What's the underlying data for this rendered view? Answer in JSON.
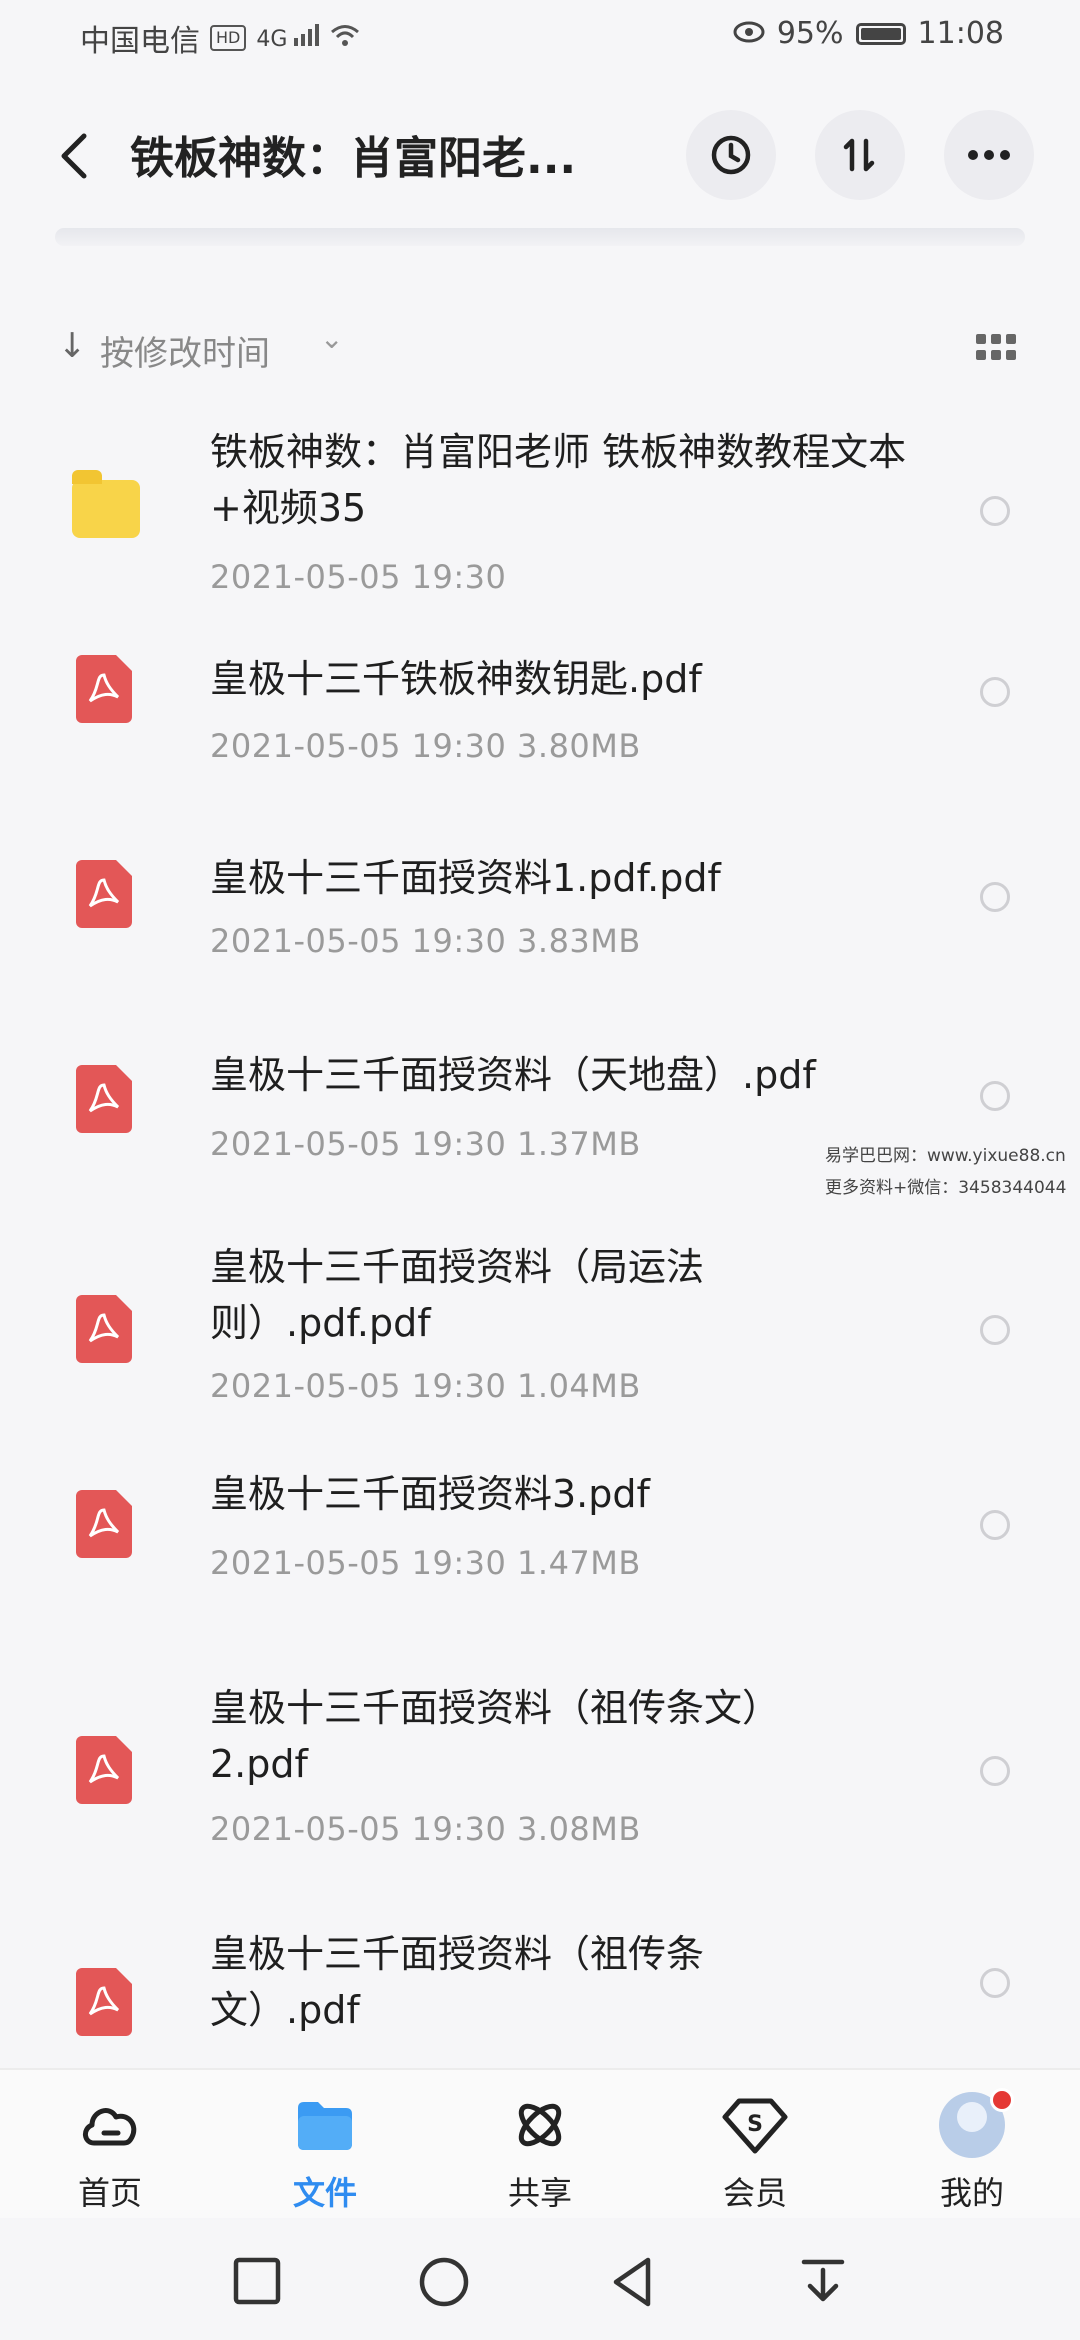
{
  "status": {
    "carrier": "中国电信",
    "hd": "HD",
    "signal": "4G",
    "battery": "95%",
    "time": "11:08"
  },
  "header": {
    "title": "铁板神数：肖富阳老...",
    "icons": [
      "back-icon",
      "history-icon",
      "sort-icon",
      "more-icon"
    ]
  },
  "sort": {
    "label": "按修改时间"
  },
  "files": [
    {
      "type": "folder",
      "name": "铁板神数：肖富阳老师  铁板神数教程文本+视频35",
      "meta": "2021-05-05  19:30"
    },
    {
      "type": "pdf",
      "name": "皇极十三千铁板神数钥匙.pdf",
      "meta": "2021-05-05  19:30  3.80MB"
    },
    {
      "type": "pdf",
      "name": "皇极十三千面授资料1.pdf.pdf",
      "meta": "2021-05-05  19:30  3.83MB"
    },
    {
      "type": "pdf",
      "name": "皇极十三千面授资料（天地盘）.pdf",
      "meta": "2021-05-05  19:30  1.37MB"
    },
    {
      "type": "pdf",
      "name": "皇极十三千面授资料（局运法则）.pdf.pdf",
      "meta": "2021-05-05  19:30  1.04MB"
    },
    {
      "type": "pdf",
      "name": "皇极十三千面授资料3.pdf",
      "meta": "2021-05-05  19:30  1.47MB"
    },
    {
      "type": "pdf",
      "name": "皇极十三千面授资料（祖传条文）2.pdf",
      "meta": "2021-05-05  19:30  3.08MB"
    },
    {
      "type": "pdf",
      "name": "皇极十三千面授资料（祖传条文）.pdf",
      "meta": ""
    }
  ],
  "watermark": {
    "line1": "易学巴巴网：www.yixue88.cn",
    "line2": "更多资料+微信：3458344044"
  },
  "tabs": [
    {
      "label": "首页",
      "icon": "cloud-icon"
    },
    {
      "label": "文件",
      "icon": "folder-icon",
      "active": true
    },
    {
      "label": "共享",
      "icon": "share-icon"
    },
    {
      "label": "会员",
      "icon": "vip-icon"
    },
    {
      "label": "我的",
      "icon": "avatar"
    }
  ],
  "colors": {
    "accent": "#2f8cf0",
    "pdf": "#e35757",
    "folder": "#f8d449"
  }
}
